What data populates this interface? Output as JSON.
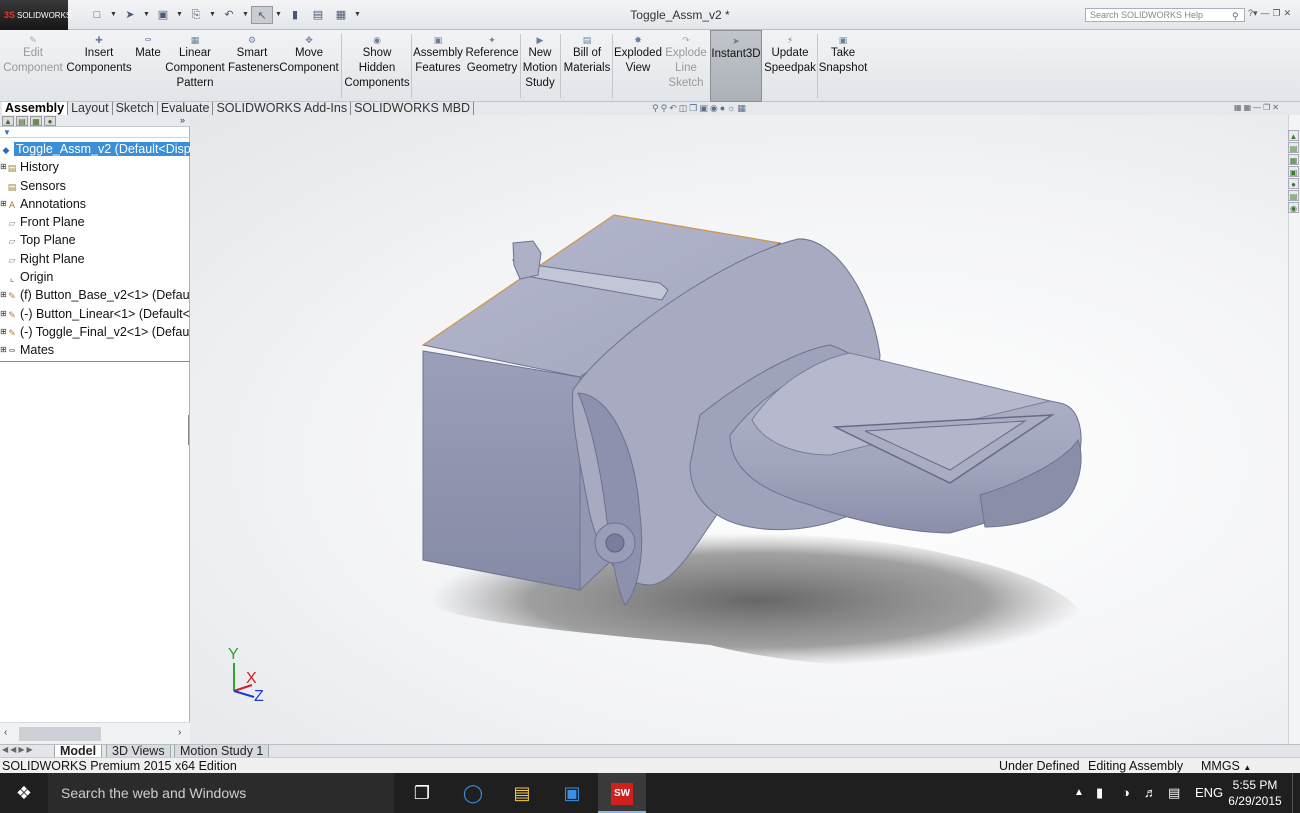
{
  "app": {
    "brand": "SOLIDWORKS",
    "brand_prefix": "3S"
  },
  "title": "Toggle_Assm_v2 *",
  "search": {
    "placeholder": "Search SOLIDWORKS Help"
  },
  "toolbar": {
    "edit_component": [
      "Edit",
      "Component"
    ],
    "insert_components": [
      "Insert",
      "Components"
    ],
    "mate": [
      "Mate"
    ],
    "linear_pattern": [
      "Linear",
      "Component",
      "Pattern"
    ],
    "smart_fasteners": [
      "Smart",
      "Fasteners"
    ],
    "move_component": [
      "Move",
      "Component"
    ],
    "show_hidden": [
      "Show",
      "Hidden",
      "Components"
    ],
    "assembly_features": [
      "Assembly",
      "Features"
    ],
    "reference_geometry": [
      "Reference",
      "Geometry"
    ],
    "new_motion_study": [
      "New",
      "Motion",
      "Study"
    ],
    "bill_of_materials": [
      "Bill of",
      "Materials"
    ],
    "exploded_view": [
      "Exploded",
      "View"
    ],
    "explode_line_sketch": [
      "Explode",
      "Line",
      "Sketch"
    ],
    "instant3d": [
      "Instant3D"
    ],
    "update_speedpak": [
      "Update",
      "Speedpak"
    ],
    "take_snapshot": [
      "Take",
      "Snapshot"
    ]
  },
  "tabs": [
    "Assembly",
    "Layout",
    "Sketch",
    "Evaluate",
    "SOLIDWORKS Add-Ins",
    "SOLIDWORKS MBD"
  ],
  "tree": {
    "root": "Toggle_Assm_v2  (Default<Displa",
    "items": [
      "History",
      "Sensors",
      "Annotations",
      "Front Plane",
      "Top Plane",
      "Right Plane",
      "Origin",
      "(f) Button_Base_v2<1> (Default",
      "(-) Button_Linear<1> (Default<",
      "(-) Toggle_Final_v2<1> (Defaul",
      "Mates"
    ]
  },
  "triad": {
    "x": "X",
    "y": "Y",
    "z": "Z"
  },
  "bottom_tabs": [
    "Model",
    "3D Views",
    "Motion Study 1"
  ],
  "status": {
    "edition": "SOLIDWORKS Premium 2015 x64 Edition",
    "definition": "Under Defined",
    "mode": "Editing Assembly",
    "units": "MMGS"
  },
  "taskbar": {
    "search": "Search the web and Windows",
    "sw_badge": "SW",
    "lang": "ENG",
    "time": "5:55 PM",
    "date": "6/29/2015"
  },
  "colors": {
    "selection": "#3a8fd8",
    "model": "#9ea3be",
    "taskbar": "#1f1f1f"
  }
}
